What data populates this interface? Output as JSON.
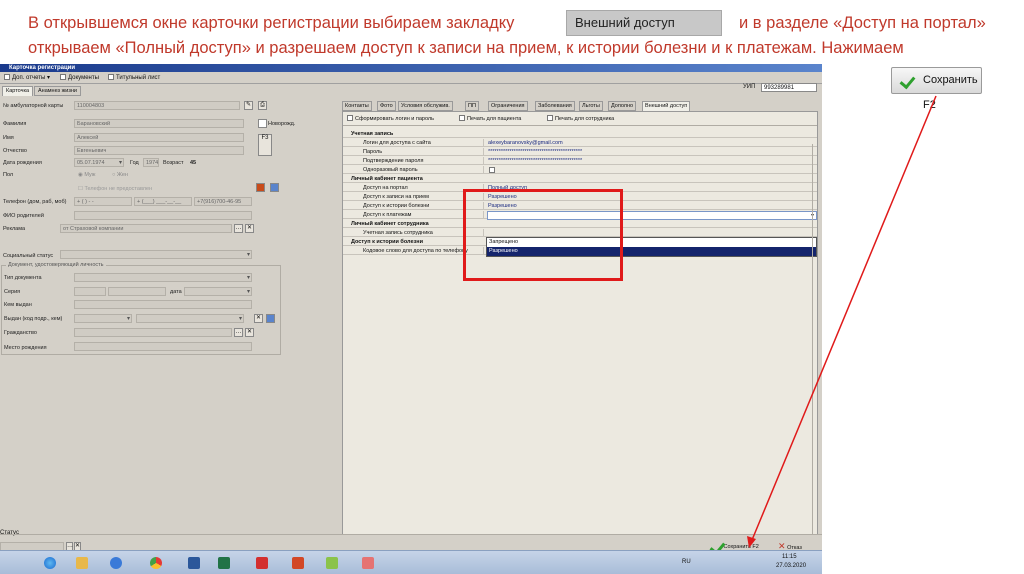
{
  "caption": {
    "line1_part1": "В открывшемся окне карточки регистрации выбираем закладку",
    "line1_part2": "и в разделе «Доступ на портал»",
    "line2": "открываем «Полный доступ» и разрешаем доступ к записи на прием, к истории болезни и к платежам. Нажимаем",
    "tab_chip": "Внешний доступ"
  },
  "side_save_button": "Сохранить F2",
  "window": {
    "title": "Карточка регистрации",
    "toolbar": [
      "Доп. отчеты",
      "Документы",
      "Титульный лист"
    ],
    "uip_label": "УИП",
    "uip_value": "993289981"
  },
  "left_tabs": [
    "Карточка",
    "Анамнез жизни"
  ],
  "left_form": {
    "card_label": "№ амбулаторной карты",
    "card_value": "110004803",
    "surname_label": "Фамилия",
    "surname_value": "Барановский",
    "name_label": "Имя",
    "name_value": "Алексей",
    "patronymic_label": "Отчество",
    "patronymic_value": "Евгеньевич",
    "newborn_label": "Новорожд.",
    "birth_label": "Дата рождения",
    "birth_value": "05.07.1974",
    "year_label": "Год",
    "year_value": "1974",
    "age_label": "Возраст",
    "age_value": "45",
    "sex_label": "Пол",
    "sex_m": "Муж",
    "sex_f": "Жен",
    "phone_not_provided": "Телефон не предоставлен",
    "phone_label": "Телефон (дом, раб, моб)",
    "phone_home": "+ ( ) - -",
    "phone_work": "+ (___) ___-__-__",
    "phone_mob": "+7(916)700-46-95",
    "parents_label": "ФИО родителей",
    "ad_label": "Реклама",
    "ad_value": "от Страховой компании",
    "social_label": "Социальный статус",
    "doc_group": "Документ, удостоверяющий личность",
    "doc_type_label": "Тип документа",
    "series_label": "Серия",
    "date_label": "дата",
    "issued_label": "Кем выдан",
    "issued_code_label": "Выдан (код подр., кем)",
    "citizenship_label": "Гражданство",
    "birthplace_label": "Место рождения"
  },
  "right_tabs": [
    "Контакты",
    "Фото",
    "Условия обслужив.",
    "ПП",
    "Ограничения",
    "Заболевания",
    "Льготы",
    "Дополно",
    "Внешний доступ"
  ],
  "right_toolbar": [
    "Сформировать логин и пароль",
    "Печать для пациента",
    "Печать для сотрудника"
  ],
  "grid": [
    {
      "key": "Учетная запись",
      "section": true,
      "value": ""
    },
    {
      "key": "Логин для доступа с сайта",
      "value": "alexeybaranovsky@gmail.com"
    },
    {
      "key": "Пароль",
      "value": "********************************************"
    },
    {
      "key": "Подтверждение пароля",
      "value": "********************************************"
    },
    {
      "key": "Одноразовый пароль",
      "value": "",
      "checkbox": true
    },
    {
      "key": "Личный кабинет пациента",
      "section": true,
      "value": ""
    },
    {
      "key": "Доступ на портал",
      "value": "Полный доступ"
    },
    {
      "key": "Доступ к записи на прием",
      "value": "Разрешено"
    },
    {
      "key": "Доступ к истории болезни",
      "value": "Разрешено"
    },
    {
      "key": "Доступ к платежам",
      "value": "",
      "dropdown": true
    },
    {
      "key": "Личный кабинет сотрудника",
      "section": true,
      "value": ""
    },
    {
      "key": "Учетная запись сотрудника",
      "value": ""
    },
    {
      "key": "Доступ к истории болезни",
      "section": true,
      "value": ""
    },
    {
      "key": "Кодовое слово для доступа по телефону",
      "value": ""
    }
  ],
  "dropdown_options": [
    "Запрещено",
    "Разрешено"
  ],
  "status_label": "Статус",
  "bottom_buttons": {
    "save": "Сохранить F2",
    "cancel": "Отказ"
  },
  "tray": {
    "lang": "RU",
    "time": "11:15",
    "date": "27.03.2020"
  },
  "colors": {
    "caption": "#c0392b",
    "highlight_box": "#e01a1a",
    "selection": "#14246c"
  }
}
